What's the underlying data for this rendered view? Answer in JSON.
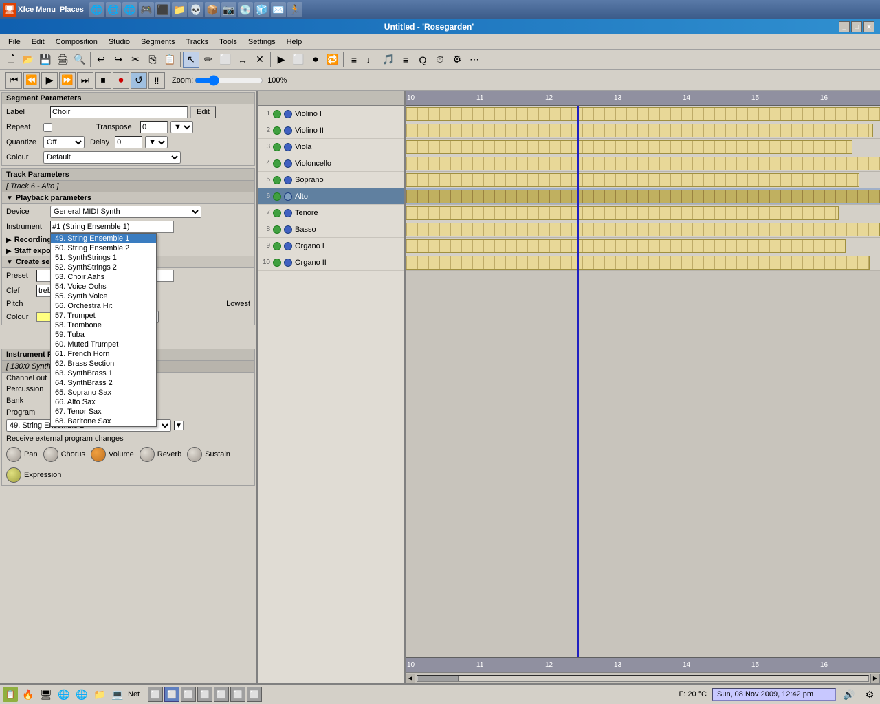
{
  "window": {
    "title": "Untitled - 'Rosegarden'",
    "os_menu": [
      "Xfce Menu",
      "Places"
    ]
  },
  "menus": [
    "File",
    "Edit",
    "Composition",
    "Studio",
    "Segments",
    "Tracks",
    "Tools",
    "Settings",
    "Help"
  ],
  "transport": {
    "zoom_label": "Zoom:",
    "zoom_value": "100%"
  },
  "segment_params": {
    "title": "Segment Parameters",
    "label_field": "Choir",
    "edit_btn": "Edit",
    "repeat_label": "Repeat",
    "transpose_label": "Transpose",
    "transpose_value": "0",
    "quantize_label": "Quantize",
    "quantize_value": "Off",
    "delay_label": "Delay",
    "delay_value": "0",
    "colour_label": "Colour",
    "colour_value": "Default"
  },
  "track_params": {
    "title": "Track Parameters",
    "track_info": "[ Track 6 - Alto ]",
    "playback_label": "Playback parameters",
    "device_label": "Device",
    "device_value": "General MIDI Synth",
    "instrument_label": "Instrument",
    "instrument_value": "#1 (String Ensemble 1)",
    "recording_filters": "Recording filters",
    "staff_export": "Staff export options",
    "create_segments": "Create segments with",
    "preset_label": "Preset",
    "preset_value": "",
    "clef_label": "Clef",
    "clef_value": "treble",
    "pitch_label": "Pitch",
    "pitch_value": "Lowest"
  },
  "dropdown": {
    "items": [
      "49. String Ensemble 1",
      "50. String Ensemble 2",
      "51. SynthStrings 1",
      "52. SynthStrings 2",
      "53. Choir Aahs",
      "54. Voice Oohs",
      "55. Synth Voice",
      "56. Orchestra Hit",
      "57. Trumpet",
      "58. Trombone",
      "59. Tuba",
      "60. Muted Trumpet",
      "61. French Horn",
      "62. Brass Section",
      "63. SynthBrass 1",
      "64. SynthBrass 2",
      "65. Soprano Sax",
      "66. Alto Sax",
      "67. Tenor Sax",
      "68. Baritone Sax"
    ],
    "selected": "49. String Ensemble 1",
    "current_value": "49. String Ensemble 1"
  },
  "instrument_params": {
    "title": "Instrument Parameters",
    "info": "[ 130:0 Synth in...rt (Qu",
    "channel_out_label": "Channel out",
    "percussion_label": "Percussion",
    "bank_label": "Bank",
    "bank_checked": true,
    "program_label": "Program",
    "program_checked": true,
    "receive_label": "Receive external program changes"
  },
  "knobs": {
    "pan_label": "Pan",
    "volume_label": "Volume",
    "sustain_label": "Sustain",
    "chorus_label": "Chorus",
    "reverb_label": "Reverb",
    "expression_label": "Expression"
  },
  "tracks": [
    {
      "num": "1",
      "name": "Violino I",
      "selected": false
    },
    {
      "num": "2",
      "name": "Violino II",
      "selected": false
    },
    {
      "num": "3",
      "name": "Viola",
      "selected": false
    },
    {
      "num": "4",
      "name": "Violoncello",
      "selected": false
    },
    {
      "num": "5",
      "name": "Soprano",
      "selected": false
    },
    {
      "num": "6",
      "name": "Alto",
      "selected": true
    },
    {
      "num": "7",
      "name": "Tenore",
      "selected": false
    },
    {
      "num": "8",
      "name": "Basso",
      "selected": false
    },
    {
      "num": "9",
      "name": "Organo I",
      "selected": false
    },
    {
      "num": "10",
      "name": "Organo II",
      "selected": false
    }
  ],
  "ruler_marks": [
    "10",
    "11",
    "12",
    "13",
    "14",
    "15",
    "16"
  ],
  "ruler_positions": [
    0,
    100,
    200,
    300,
    400,
    500,
    600
  ],
  "status": {
    "net_label": "Net",
    "temp": "F: 20 °C",
    "datetime": "Sun, 08 Nov 2009, 12:42 pm"
  },
  "colour_section": {
    "label": "Colour",
    "value": "Default"
  }
}
